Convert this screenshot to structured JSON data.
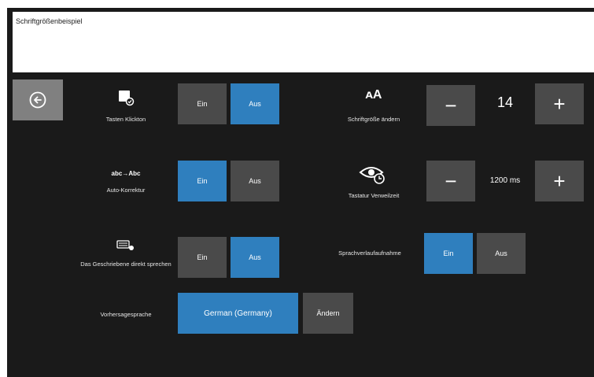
{
  "preview": {
    "text": "Schriftgrößenbeispiel"
  },
  "settings": {
    "key_click": {
      "label": "Tasten Klickton",
      "on": "Ein",
      "off": "Aus"
    },
    "autocorrect": {
      "icon_text": "abc→Abc",
      "label": "Auto-Korrektur",
      "on": "Ein",
      "off": "Aus"
    },
    "speak_written": {
      "label": "Das Geschriebene direkt sprechen",
      "on": "Ein",
      "off": "Aus"
    },
    "prediction_language": {
      "label": "Vorhersagesprache",
      "value": "German (Germany)",
      "change": "Ändern"
    },
    "font_size": {
      "icon_text": "ᴀA",
      "label": "Schriftgröße ändern",
      "value": "14",
      "minus": "−",
      "plus": "+"
    },
    "dwell_time": {
      "label": "Tastatur Verweilzeit",
      "value": "1200 ms",
      "minus": "−",
      "plus": "+"
    },
    "speech_history": {
      "label": "Sprachverlaufaufnahme",
      "on": "Ein",
      "off": "Aus"
    }
  },
  "icons": {
    "back": "back-arrow-icon",
    "key_click": "keyboard-click-icon",
    "speak": "keyboard-speak-icon",
    "dwell": "eye-clock-icon"
  },
  "colors": {
    "accent": "#2f7fbe",
    "button": "#4a4a4a",
    "background": "#1a1a1a",
    "back_button": "#808080"
  }
}
